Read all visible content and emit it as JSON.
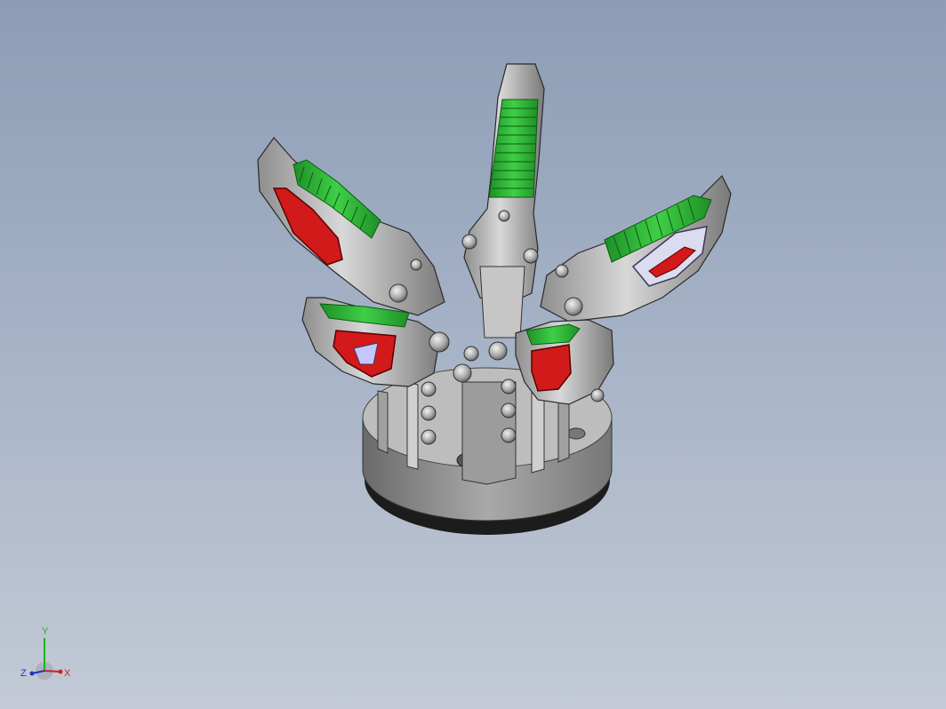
{
  "viewport": {
    "background_top": "#8c9db5",
    "background_bottom": "#c3cad6"
  },
  "model": {
    "grip_color": "#2eab35",
    "pocket_color": "#d21a1a",
    "body_color": "#b4b4b4",
    "base_ring_color": "#1e1e1e"
  },
  "triad": {
    "y_label": "Y",
    "x_label": "X",
    "z_label": "Z",
    "y_color": "#1db31d",
    "x_color": "#cc2222",
    "z_color": "#2233bb"
  }
}
